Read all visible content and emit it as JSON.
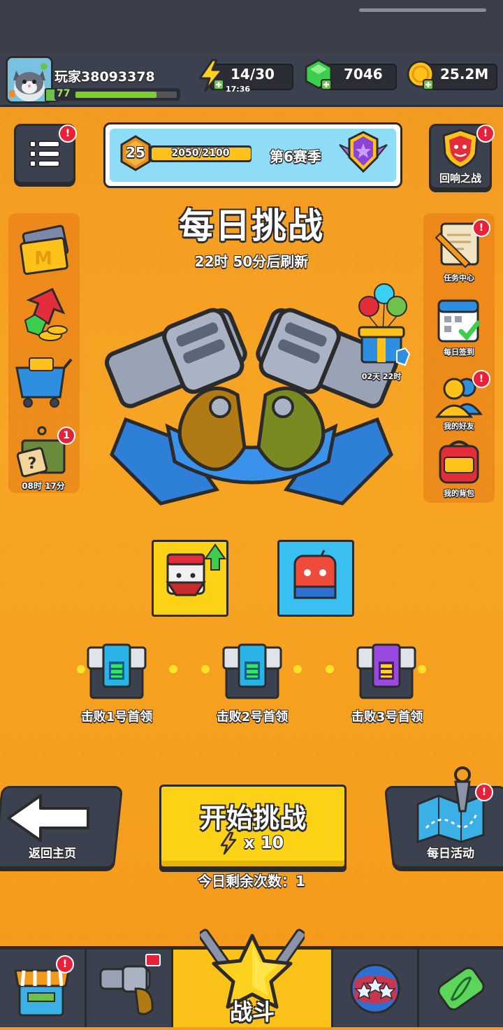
{
  "player": {
    "name": "玩家38093378",
    "level": "77",
    "xp_fraction": 0.8
  },
  "resources": {
    "energy": {
      "value": "14/30",
      "timer": "17:36"
    },
    "gems": {
      "value": "7046"
    },
    "coins": {
      "value": "25.2M"
    }
  },
  "season": {
    "level": "25",
    "xp": "2050/2100",
    "xp_fraction": 0.976,
    "label": "第6赛季"
  },
  "top_right_button": {
    "label": "回响之战"
  },
  "title": "每日挑战",
  "refresh_text": "22时 50分后刷新",
  "left_side": {
    "crate_timer": "08时 17分",
    "crate_badge": "1"
  },
  "gift_timer": "02天 22时",
  "right_side": {
    "items": [
      {
        "label": "任务中心",
        "badge": true
      },
      {
        "label": "每日签到",
        "badge": false
      },
      {
        "label": "我的好友",
        "badge": true
      },
      {
        "label": "我的背包",
        "badge": false
      }
    ]
  },
  "bosses": [
    {
      "label": "击败1号首领"
    },
    {
      "label": "击败2号首领"
    },
    {
      "label": "击败3号首领"
    }
  ],
  "start": {
    "label": "开始挑战",
    "cost": "x 10",
    "remaining": "今日剩余次数：1"
  },
  "back_button": {
    "label": "返回主页"
  },
  "daily_event_button": {
    "label": "每日活动"
  },
  "bottom_nav": {
    "active_label": "战斗"
  },
  "badge_mark": "!",
  "colors": {
    "accent": "#f59a1c",
    "panel": "#3c4150",
    "yellow_button": "#fbd216",
    "badge_red": "#e8213a"
  }
}
